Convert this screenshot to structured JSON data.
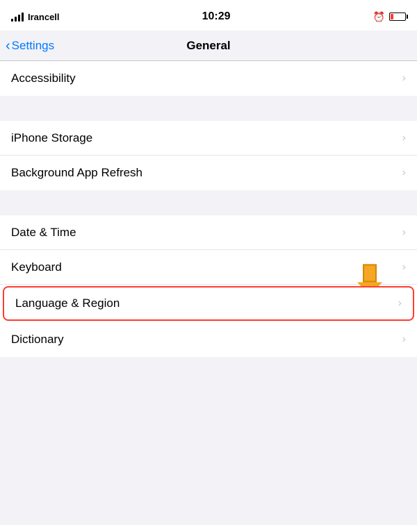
{
  "statusBar": {
    "carrier": "Irancell",
    "time": "10:29"
  },
  "navBar": {
    "backLabel": "Settings",
    "title": "General"
  },
  "sections": [
    {
      "id": "section1",
      "rows": [
        {
          "id": "accessibility",
          "label": "Accessibility"
        }
      ]
    },
    {
      "id": "section2",
      "rows": [
        {
          "id": "iphone-storage",
          "label": "iPhone Storage"
        },
        {
          "id": "background-app-refresh",
          "label": "Background App Refresh"
        }
      ]
    },
    {
      "id": "section3",
      "rows": [
        {
          "id": "date-time",
          "label": "Date & Time"
        },
        {
          "id": "keyboard",
          "label": "Keyboard"
        },
        {
          "id": "language-region",
          "label": "Language & Region",
          "highlighted": true
        },
        {
          "id": "dictionary",
          "label": "Dictionary"
        }
      ]
    }
  ]
}
